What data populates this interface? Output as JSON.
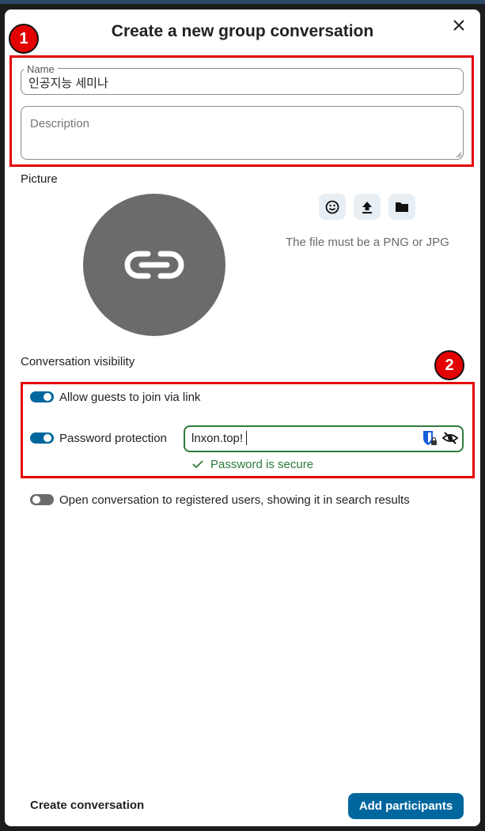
{
  "dialog": {
    "title": "Create a new group conversation",
    "close_icon": "close-icon"
  },
  "annotations": {
    "badge_1": "1",
    "badge_2": "2",
    "highlight_color": "#e30000"
  },
  "name_field": {
    "label": "Name",
    "value": "인공지능 세미나"
  },
  "description_field": {
    "placeholder": "Description",
    "value": ""
  },
  "picture": {
    "label": "Picture",
    "avatar_icon": "link-icon",
    "buttons": [
      {
        "icon": "emoji-icon"
      },
      {
        "icon": "upload-icon"
      },
      {
        "icon": "folder-icon"
      }
    ],
    "hint": "The file must be a PNG or JPG"
  },
  "visibility": {
    "label": "Conversation visibility",
    "allow_guests": {
      "label": "Allow guests to join via link",
      "enabled": true
    },
    "password_protection": {
      "label": "Password protection",
      "enabled": true,
      "value": "lnxon.top!",
      "status": "Password is secure",
      "status_color": "#2d7b3a"
    },
    "open_conversation": {
      "label": "Open conversation to registered users, showing it in search results",
      "enabled": false
    }
  },
  "footer": {
    "create_label": "Create conversation",
    "add_participants_label": "Add participants",
    "primary_color": "#00679e"
  }
}
